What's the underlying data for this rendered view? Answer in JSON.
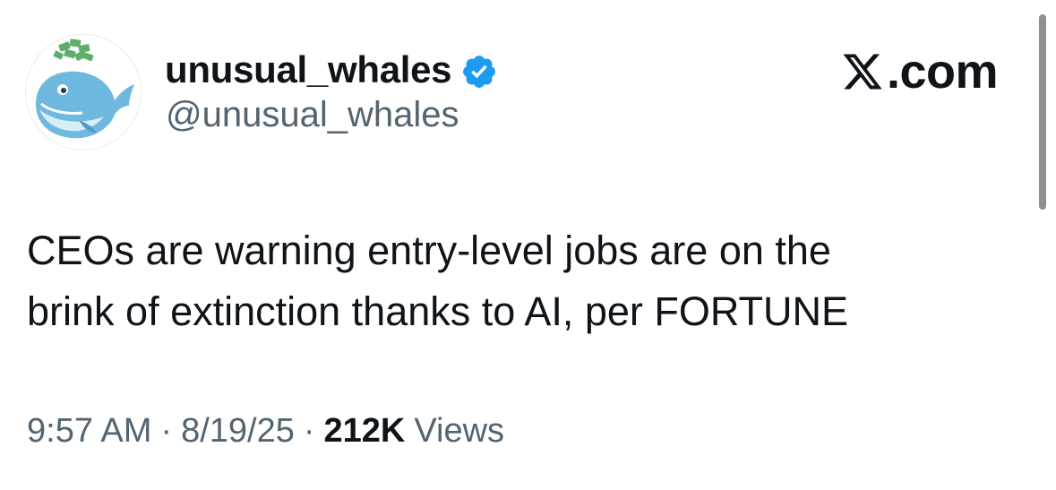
{
  "author": {
    "display_name": "unusual_whales",
    "handle": "@unusual_whales",
    "verified": true,
    "verified_color": "#1d9bf0",
    "avatar_icon": "whale-avatar-icon"
  },
  "brand": {
    "text": ".com",
    "logo_icon": "x-logo-icon"
  },
  "tweet": {
    "lines": [
      "CEOs are warning entry-level jobs are on the",
      "brink of extinction thanks to AI, per FORTUNE"
    ]
  },
  "meta": {
    "time": "9:57 AM",
    "date": "8/19/25",
    "separator": "·",
    "views_count": "212K",
    "views_label": "Views"
  },
  "colors": {
    "text_primary": "#0f1419",
    "text_secondary": "#536471",
    "accent_blue": "#1d9bf0"
  }
}
